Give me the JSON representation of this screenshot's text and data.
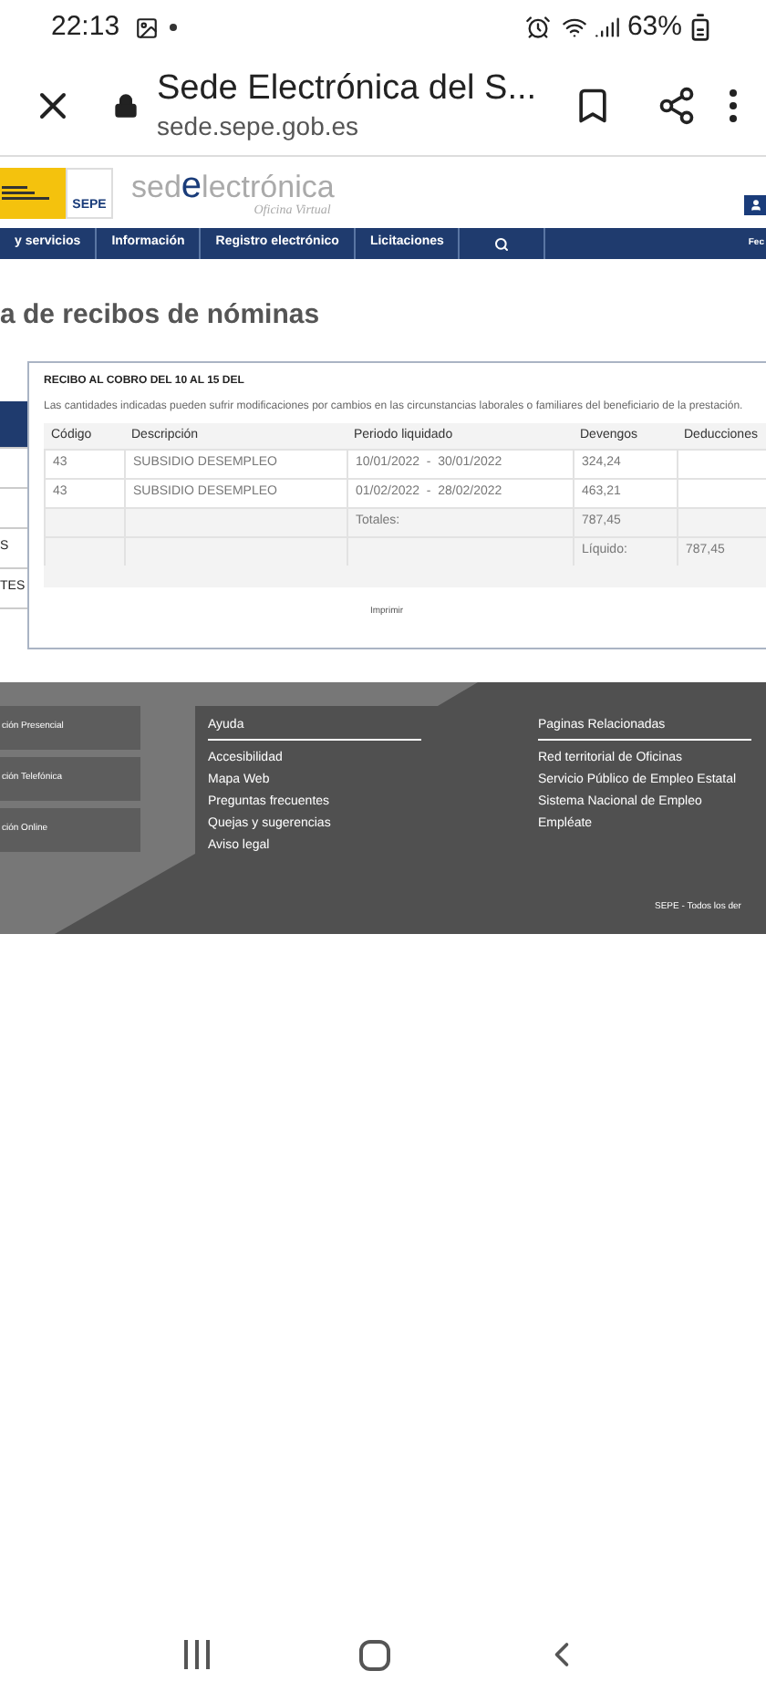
{
  "status_bar": {
    "time": "22:13",
    "battery": "63%"
  },
  "browser": {
    "title": "Sede Electrónica del S...",
    "url": "sede.sepe.gob.es"
  },
  "site_header": {
    "agency_logo": "SEPE",
    "brand_start": "sed",
    "brand_letter": "e",
    "brand_end": "lectrónica",
    "brand_subtitle": "Oficina Virtual"
  },
  "nav": {
    "items": [
      {
        "label": "y servicios",
        "kind": "text"
      },
      {
        "label": "Información",
        "kind": "text"
      },
      {
        "label": "Registro electrónico",
        "kind": "text"
      },
      {
        "label": "Licitaciones",
        "kind": "text"
      },
      {
        "kind": "search"
      }
    ],
    "date_label": "Fec"
  },
  "page_title": "a de recibos de nóminas",
  "sidebar": {
    "items": [
      {
        "selected": true
      },
      {
        "selected": false
      },
      {
        "selected": false
      },
      {
        "label": "S",
        "selected": false
      },
      {
        "label": "TES",
        "selected": false
      }
    ]
  },
  "receipt": {
    "heading": "RECIBO AL COBRO DEL 10 AL 15 DEL",
    "notice": "Las cantidades indicadas pueden sufrir modificaciones por cambios en las circunstancias laborales o familiares del beneficiario de la prestación.",
    "columns": [
      "Código",
      "Descripción",
      "Periodo liquidado",
      "Devengos",
      "Deducciones"
    ],
    "rows": [
      [
        "43",
        "SUBSIDIO DESEMPLEO",
        "10/01/2022  -  30/01/2022",
        "324,24",
        ""
      ],
      [
        "43",
        "SUBSIDIO DESEMPLEO",
        "01/02/2022  -  28/02/2022",
        "463,21",
        ""
      ],
      [
        "",
        "",
        "Totales:",
        "787,45",
        ""
      ],
      [
        "",
        "",
        "",
        "Líquido:",
        "787,45"
      ]
    ],
    "print": "Imprimir"
  },
  "footer": {
    "contact_buttons": [
      "ción Presencial",
      "ción Telefónica",
      "ción Online"
    ],
    "help": {
      "title": "Ayuda",
      "links": [
        "Accesibilidad",
        "Mapa Web",
        "Preguntas frecuentes",
        "Quejas y sugerencias",
        "Aviso legal"
      ]
    },
    "related": {
      "title": "Paginas Relacionadas",
      "links": [
        "Red territorial de Oficinas",
        "Servicio Público de Empleo Estatal",
        "Sistema Nacional de Empleo",
        "Empléate"
      ]
    },
    "copyright": "SEPE - Todos los der"
  }
}
